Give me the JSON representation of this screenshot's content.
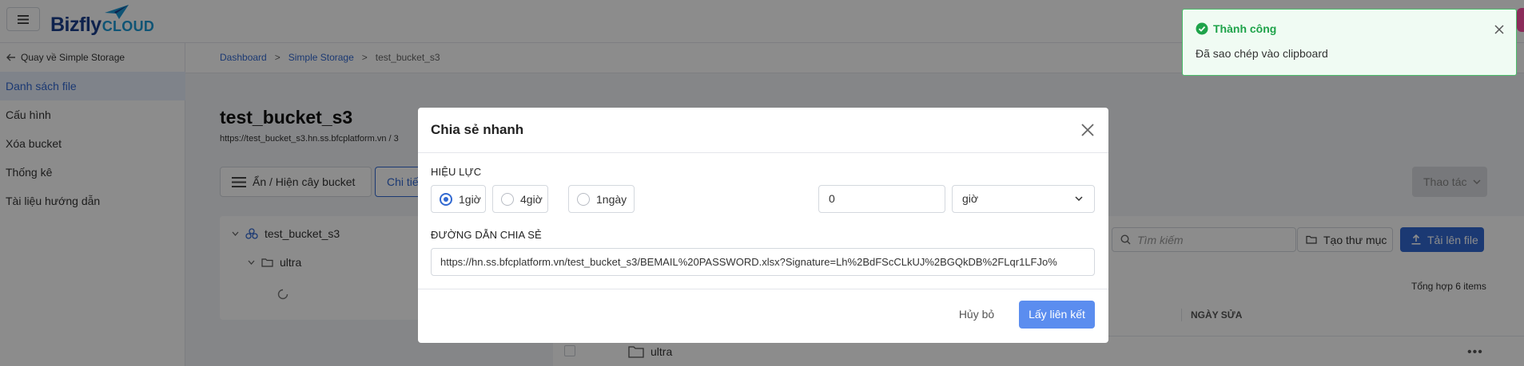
{
  "header": {
    "logo_text": "Bizfly",
    "logo_cloud": "CLOUD"
  },
  "sidebar": {
    "back_label": "Quay về Simple Storage",
    "items": [
      {
        "label": "Danh sách file"
      },
      {
        "label": "Cấu hình"
      },
      {
        "label": "Xóa bucket"
      },
      {
        "label": "Thống kê"
      },
      {
        "label": "Tài liệu hướng dẫn"
      }
    ]
  },
  "breadcrumb": {
    "items": [
      "Dashboard",
      "Simple Storage",
      "test_bucket_s3"
    ],
    "separator": ">"
  },
  "bucket": {
    "title": "test_bucket_s3",
    "url": "https://test_bucket_s3.hn.ss.bfcplatform.vn / 3"
  },
  "toolbar": {
    "toggle_tree_label": "Ẩn / Hiện cây bucket",
    "detail_label": "Chi tiết",
    "actions_label": "Thao tác"
  },
  "tree": {
    "root": "test_bucket_s3",
    "child": "ultra"
  },
  "files": {
    "search_placeholder": "Tìm kiếm",
    "new_folder_label": "Tạo thư mục",
    "upload_label": "Tải lên file",
    "total_label": "Tổng hợp 6 items",
    "modified_column": "NGÀY SỬA",
    "rows": [
      {
        "name": "ultra"
      }
    ]
  },
  "modal": {
    "title": "Chia sẻ nhanh",
    "validity_label": "HIỆU LỰC",
    "options": [
      {
        "label": "1giờ",
        "selected": true
      },
      {
        "label": "4giờ",
        "selected": false
      },
      {
        "label": "1ngày",
        "selected": false
      }
    ],
    "custom_value": "0",
    "unit_value": "giờ",
    "share_link_label": "ĐƯỜNG DẪN CHIA SẺ",
    "share_url": "https://hn.ss.bfcplatform.vn/test_bucket_s3/BEMAIL%20PASSWORD.xlsx?Signature=Lh%2BdFScCLkUJ%2BGQkDB%2FLqr1LFJo%",
    "cancel_label": "Hủy bỏ",
    "get_link_label": "Lấy liên kết"
  },
  "toast": {
    "title": "Thành công",
    "message": "Đã sao chép vào clipboard"
  },
  "colors": {
    "primary": "#3269d1",
    "success": "#1ea34a",
    "success_border": "#4bbf6b",
    "brand_dark": "#1b3f8c",
    "brand_light": "#1d9ad6"
  }
}
